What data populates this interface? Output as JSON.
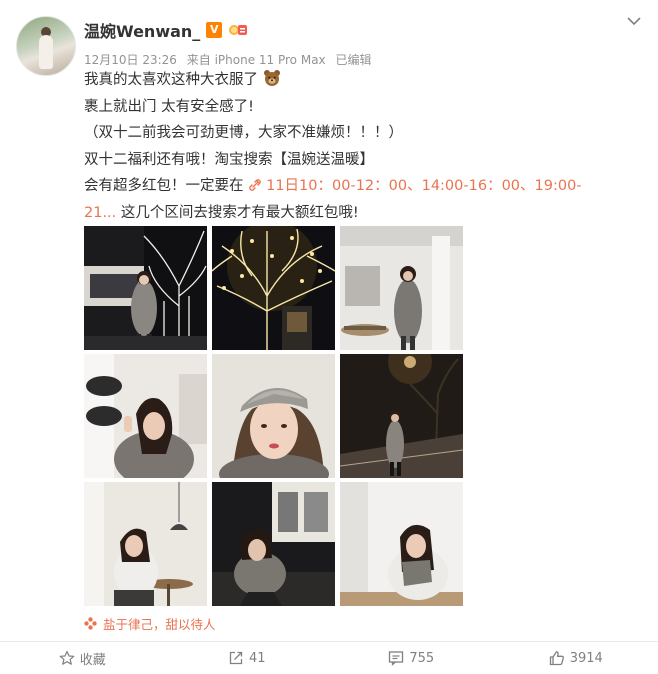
{
  "user": {
    "name": "温婉Wenwan_",
    "verified_badge": "V"
  },
  "meta": {
    "time": "12月10日 23:26",
    "source": "来自 iPhone 11 Pro Max",
    "edited": "已编辑"
  },
  "post": {
    "line1": "我真的太喜欢这种大衣服了",
    "line2": "裹上就出门  太有安全感了!",
    "line3": "（双十二前我会可劲更博，大家不准嫌烦！！！）",
    "line4": "双十二福利还有哦！淘宝搜索【温婉送温暖】",
    "line5_prefix": "会有超多红包！一定要在 ",
    "link_part1": "11日10：00-12：00、14:00-16：00、19:00-",
    "link_part2": "21...",
    "line6_suffix": " 这几个区间去搜索才有最大额红包哦!"
  },
  "photos": [
    {
      "name": "photo-1",
      "desc": "night-tree-lights-coat"
    },
    {
      "name": "photo-2",
      "desc": "illuminated-tree"
    },
    {
      "name": "photo-3",
      "desc": "white-cafe-standing"
    },
    {
      "name": "photo-4",
      "desc": "cafe-peace-sign"
    },
    {
      "name": "photo-5",
      "desc": "grey-cap-portrait"
    },
    {
      "name": "photo-6",
      "desc": "night-street"
    },
    {
      "name": "photo-7",
      "desc": "cafe-sitting"
    },
    {
      "name": "photo-8",
      "desc": "night-crouching"
    },
    {
      "name": "photo-9",
      "desc": "white-room-sitting"
    }
  ],
  "topic": {
    "label": "盐于律己，甜以待人"
  },
  "actions": {
    "favorite_label": "收藏",
    "repost_count": "41",
    "comment_count": "755",
    "like_count": "3914"
  },
  "colors": {
    "link": "#eb7350",
    "verified": "#ff8200",
    "muted": "#939393"
  }
}
